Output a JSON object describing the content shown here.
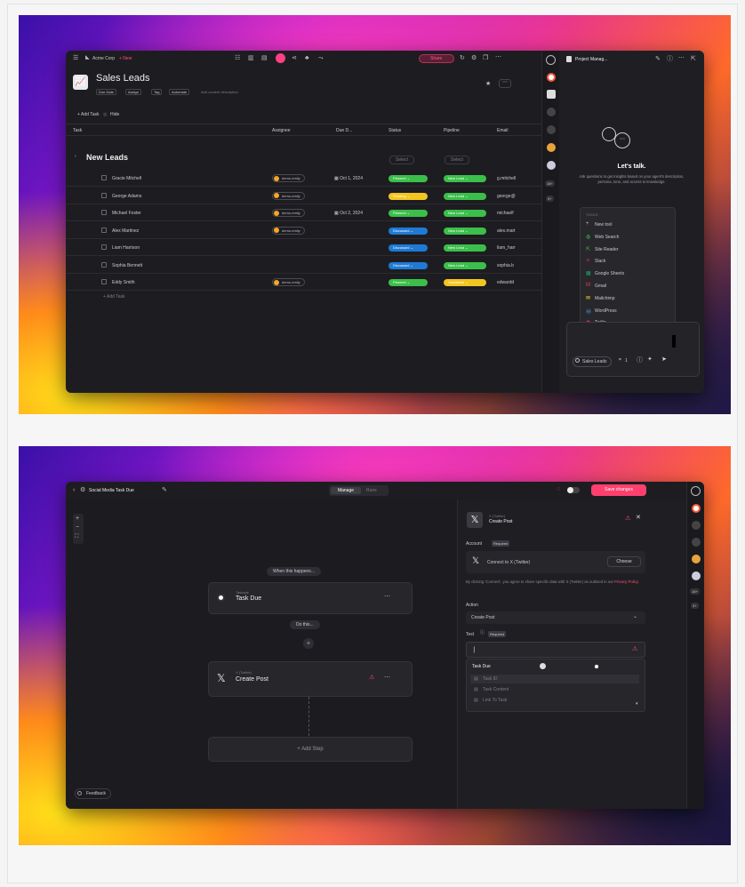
{
  "screen1": {
    "workspace": "Acme Corp",
    "new_label": "+ New",
    "share_label": "Share",
    "title": "Sales Leads",
    "toolbar": [
      "Due Date",
      "Assign",
      "Tag",
      "Automate"
    ],
    "toolbar_hint": "Add content description",
    "add_task": "+ Add Task",
    "hide": "Hide",
    "columns": [
      "Task",
      "Assignee",
      "Due D...",
      "Status",
      "Pipeline",
      "Email"
    ],
    "group": "New Leads",
    "select_label": "Select",
    "rows": [
      {
        "name": "Gracie Mitchell",
        "assignee": "demo-emily",
        "due": "Oct 1, 2024",
        "status": "Planned",
        "status_color": "#3bbf4a",
        "pipeline": "New Lead",
        "email": "g.mitchell"
      },
      {
        "name": "George Adams",
        "assignee": "demo-emily",
        "due": "",
        "status": "Pending",
        "status_color": "#f3c520",
        "pipeline": "New Lead",
        "email": "george@"
      },
      {
        "name": "Michael Foster",
        "assignee": "demo-emily",
        "due": "Oct 2, 2024",
        "status": "Planned",
        "status_color": "#3bbf4a",
        "pipeline": "New Lead",
        "email": "michaelf"
      },
      {
        "name": "Alex Martinez",
        "assignee": "demo-emily",
        "due": "",
        "status": "Discussed",
        "status_color": "#1f7ad6",
        "pipeline": "New Lead",
        "email": "alex.mart"
      },
      {
        "name": "Liam Harrison",
        "assignee": "",
        "due": "",
        "status": "Discussed",
        "status_color": "#1f7ad6",
        "pipeline": "New Lead",
        "email": "liam_harr"
      },
      {
        "name": "Sophia Bennett",
        "assignee": "",
        "due": "",
        "status": "Discussed",
        "status_color": "#1f7ad6",
        "pipeline": "New Lead",
        "email": "sophia.b"
      },
      {
        "name": "Eddy Smith",
        "assignee": "demo-emily",
        "due": "",
        "status": "Planned",
        "status_color": "#3bbf4a",
        "pipeline": "Contacted",
        "email": "edwardd"
      }
    ],
    "add_task_row": "+ Add Task",
    "side_title": "Project Manag...",
    "lets_talk": "Let's talk.",
    "lets_talk_desc": "Ask questions to get insights based on your agent's description, persona, tone, and access to knowledge.",
    "tools_header": "TOOLS",
    "tools": [
      "New tool",
      "Web Search",
      "Site Reader",
      "Slack",
      "Google Sheets",
      "Gmail",
      "Mailchimp",
      "WordPress",
      "Twilio",
      "HubSpot"
    ],
    "chip": "Sales Leads",
    "chip_count": "1",
    "rail_badges": [
      "18+",
      "3+"
    ]
  },
  "screen2": {
    "title": "Social Media Task Due",
    "tabs": [
      "Manage",
      "Runs"
    ],
    "save": "Save changes",
    "trigger_hint": "When this happens...",
    "trigger_app": "Taskade",
    "trigger_name": "Task Due",
    "action_hint": "Do this...",
    "action_app": "X (Twitter)",
    "action_name": "Create Post",
    "add_step": "+ Add Step",
    "feedback": "Feedback",
    "panel_app": "X (Twitter)",
    "panel_name": "Create Post",
    "account_label": "Account",
    "required": "Required",
    "connect": "Connect to X (Twitter)",
    "choose": "Choose",
    "consent": "By clicking 'Connect', you agree to share specific data with X (Twitter) as outlined in our",
    "privacy": "Privacy Policy.",
    "action_label": "Action",
    "action_value": "Create Post",
    "text_label": "Text",
    "dropdown_header": "Task Due",
    "dropdown_items": [
      "Task ID",
      "Task Content",
      "Link To Task"
    ],
    "rail_badges": [
      "18+",
      "3+"
    ]
  }
}
